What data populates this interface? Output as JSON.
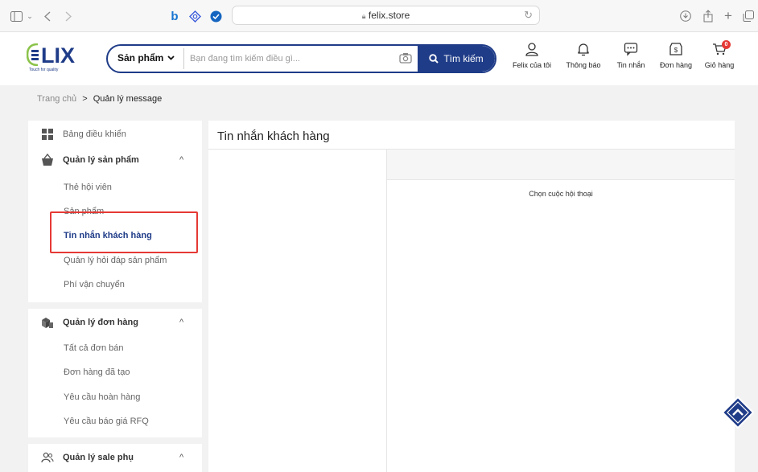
{
  "browser": {
    "url": "felix.store"
  },
  "header": {
    "logo_text": "LIX",
    "logo_tagline": "Touch for quality",
    "search": {
      "category": "Sản phẩm",
      "placeholder": "Bạn đang tìm kiếm điều gì...",
      "button_label": "Tìm kiếm"
    },
    "nav": [
      {
        "label": "Felix của tôi",
        "icon": "user-icon"
      },
      {
        "label": "Thông báo",
        "icon": "bell-icon"
      },
      {
        "label": "Tin nhắn",
        "icon": "message-icon"
      },
      {
        "label": "Đơn hàng",
        "icon": "order-icon"
      },
      {
        "label": "Giỏ hàng",
        "icon": "cart-icon",
        "badge": "0"
      }
    ]
  },
  "breadcrumb": {
    "home": "Trang chủ",
    "separator": ">",
    "current": "Quản lý message"
  },
  "sidebar": {
    "dashboard": "Bảng điều khiển",
    "product_group": {
      "label": "Quản lý sản phẩm",
      "items": [
        "Thẻ hội viên",
        "Sản phẩm",
        "Tin nhắn khách hàng",
        "Quản lý hỏi đáp sản phẩm",
        "Phí vận chuyển"
      ]
    },
    "order_group": {
      "label": "Quản lý đơn hàng",
      "items": [
        "Tất cả đơn bán",
        "Đơn hàng đã tạo",
        "Yêu cầu hoàn hàng",
        "Yêu cầu báo giá RFQ"
      ]
    },
    "sale_group": {
      "label": "Quản lý sale phụ"
    },
    "active_item": "Tin nhắn khách hàng"
  },
  "main": {
    "title": "Tin nhắn khách hàng",
    "empty_state": "Chọn cuộc hội thoại"
  },
  "colors": {
    "brand": "#1f3c88",
    "highlight": "#e53935",
    "badge": "#e53935"
  }
}
